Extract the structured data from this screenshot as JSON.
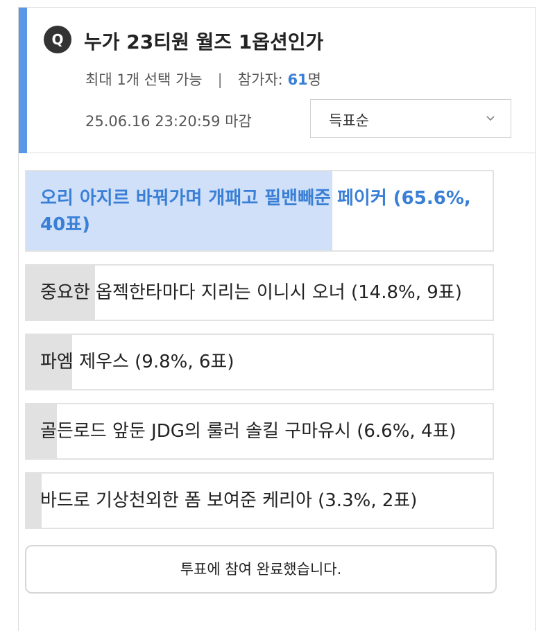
{
  "poll": {
    "badge": "Q",
    "question": "누가 23티원 월즈 1옵션인가",
    "max_select": "최대 1개 선택 가능",
    "separator": "|",
    "participants_label": "참가자: ",
    "participants_count": "61",
    "participants_unit": "명",
    "deadline": "25.06.16 23:20:59 마감",
    "sort_label": "득표순"
  },
  "options": [
    {
      "text": "오리 아지르 바꿔가며 개패고 필밴빼준 페이커 (65.6%, 40표)",
      "percent": 65.6
    },
    {
      "text": "중요한 옵젝한타마다 지리는 이니시 오너 (14.8%, 9표)",
      "percent": 14.8
    },
    {
      "text": "파엠 제우스 (9.8%, 6표)",
      "percent": 9.8
    },
    {
      "text": "골든로드 앞둔 JDG의 룰러 솔킬 구마유시 (6.6%, 4표)",
      "percent": 6.6
    },
    {
      "text": "바드로 기상천외한 폼 보여준 케리아 (3.3%, 2표)",
      "percent": 3.3
    }
  ],
  "footer": {
    "done_label": "투표에 참여 완료했습니다."
  },
  "icons": {
    "sort": "chevron-down-icon"
  },
  "colors": {
    "accent": "#5b97e8",
    "top_fill": "#cfe0f8",
    "top_text": "#3a7fd6",
    "other_fill": "#e1e1e1"
  }
}
